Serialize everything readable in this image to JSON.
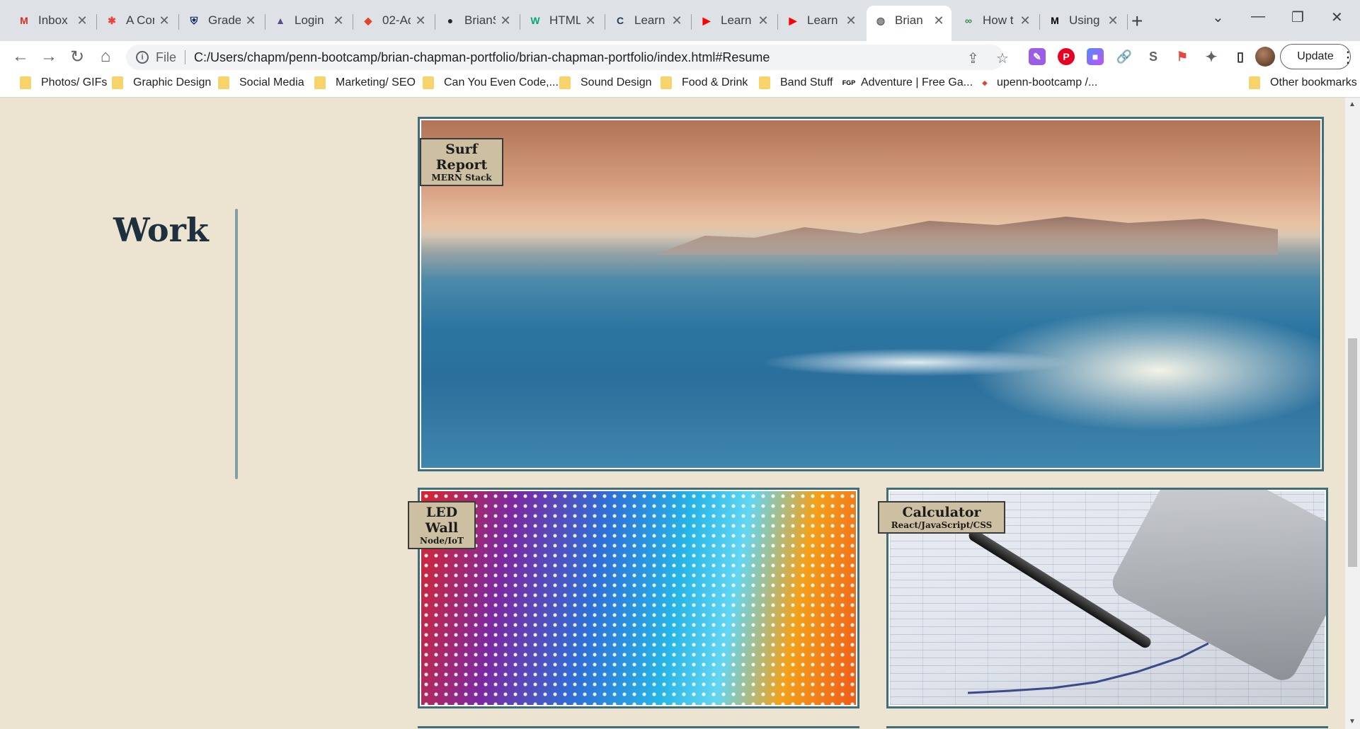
{
  "browser": {
    "tabs": [
      {
        "title": "Inbox",
        "icon": "gmail-icon",
        "color": "#d93025",
        "glyph": "M"
      },
      {
        "title": "A Con",
        "icon": "asterisk-icon",
        "color": "#e8453c",
        "glyph": "✱"
      },
      {
        "title": "Grade",
        "icon": "penn-shield-icon",
        "color": "#011f5b",
        "glyph": "⛨"
      },
      {
        "title": "Login",
        "icon": "mountain-icon",
        "color": "#5b4b8a",
        "glyph": "▲"
      },
      {
        "title": "02-Ad",
        "icon": "gitlab-icon",
        "color": "#e24329",
        "glyph": "◆"
      },
      {
        "title": "BrianS",
        "icon": "github-icon",
        "color": "#24292f",
        "glyph": "●"
      },
      {
        "title": "HTML",
        "icon": "w3schools-icon",
        "color": "#04aa6d",
        "glyph": "W"
      },
      {
        "title": "Learn",
        "icon": "codecademy-icon",
        "color": "#204056",
        "glyph": "C"
      },
      {
        "title": "Learn",
        "icon": "youtube-icon",
        "color": "#ff0000",
        "glyph": "▶"
      },
      {
        "title": "Learn",
        "icon": "youtube-icon",
        "color": "#ff0000",
        "glyph": "▶"
      },
      {
        "title": "Brian",
        "icon": "globe-icon",
        "color": "#5f6368",
        "glyph": "◍",
        "active": true
      },
      {
        "title": "How t",
        "icon": "gfg-icon",
        "color": "#2f8d46",
        "glyph": "∞"
      },
      {
        "title": "Using",
        "icon": "mdn-icon",
        "color": "#000000",
        "glyph": "M"
      }
    ],
    "address": {
      "scheme": "File",
      "url": "C:/Users/chapm/penn-bootcamp/brian-chapman-portfolio/brian-chapman-portfolio/index.html#Resume"
    },
    "update_label": "Update",
    "bookmarks": [
      {
        "label": "Photos/ GIFs",
        "type": "folder"
      },
      {
        "label": "Graphic Design",
        "type": "folder"
      },
      {
        "label": "Social Media",
        "type": "folder"
      },
      {
        "label": "Marketing/ SEO",
        "type": "folder"
      },
      {
        "label": "Can You Even Code,...",
        "type": "folder"
      },
      {
        "label": "Sound Design",
        "type": "folder"
      },
      {
        "label": "Food & Drink",
        "type": "folder"
      },
      {
        "label": "Band Stuff",
        "type": "folder"
      },
      {
        "label": "Adventure | Free Ga...",
        "type": "site",
        "glyph": "FGP"
      },
      {
        "label": "upenn-bootcamp /...",
        "type": "site",
        "glyph": "◆"
      }
    ],
    "bookmarks_more": "»",
    "other_bookmarks": "Other bookmarks"
  },
  "page": {
    "section_heading": "Work",
    "projects": [
      {
        "title": "Surf Report",
        "stack": "MERN Stack"
      },
      {
        "title": "LED Wall",
        "stack": "Node/IoT"
      },
      {
        "title": "Calculator",
        "stack": "React/JavaScript/CSS"
      }
    ]
  },
  "colors": {
    "page_background": "#ece4d1",
    "accent_border": "#3f6f7d",
    "label_background": "#cdbfa1",
    "heading_text": "#1e2f3d"
  }
}
